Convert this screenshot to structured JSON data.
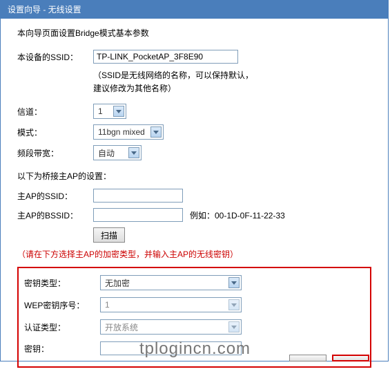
{
  "title": "设置向导 - 无线设置",
  "intro": "本向导页面设置Bridge模式基本参数",
  "ssid": {
    "label": "本设备的SSID：",
    "value": "TP-LINK_PocketAP_3F8E90",
    "hint1": "（SSID是无线网络的名称，可以保持默认，",
    "hint2": "建议修改为其他名称）"
  },
  "channel": {
    "label": "信道：",
    "value": "1"
  },
  "mode": {
    "label": "模式：",
    "value": "11bgn mixed"
  },
  "bandwidth": {
    "label": "频段带宽：",
    "value": "自动"
  },
  "bridge_section": "以下为桥接主AP的设置：",
  "main_ssid": {
    "label": "主AP的SSID：",
    "value": ""
  },
  "main_bssid": {
    "label": "主AP的BSSID：",
    "value": "",
    "example": "例如：00-1D-0F-11-22-33"
  },
  "scan_btn": "扫描",
  "red_hint": "（请在下方选择主AP的加密类型，并输入主AP的无线密钥）",
  "key_type": {
    "label": "密钥类型：",
    "value": "无加密"
  },
  "wep_index": {
    "label": "WEP密钥序号：",
    "value": "1"
  },
  "auth_type": {
    "label": "认证类型：",
    "value": "开放系统"
  },
  "key": {
    "label": "密钥：",
    "value": ""
  },
  "watermark": "tplogincn.com"
}
